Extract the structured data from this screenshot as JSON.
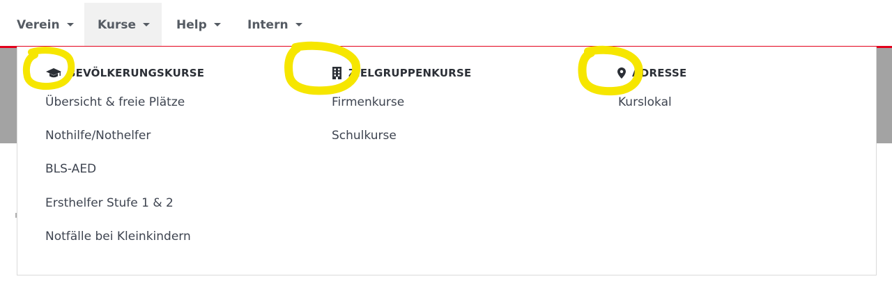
{
  "nav": {
    "items": [
      {
        "label": "Verein"
      },
      {
        "label": "Kurse"
      },
      {
        "label": "Help"
      },
      {
        "label": "Intern"
      }
    ]
  },
  "dropdown": {
    "columns": [
      {
        "heading": "BEVÖLKERUNGSKURSE",
        "icon": "graduation-cap-icon",
        "links": [
          "Übersicht & freie Plätze",
          "Nothilfe/Nothelfer",
          "BLS-AED",
          "Ersthelfer Stufe 1 & 2",
          "Notfälle bei Kleinkindern"
        ]
      },
      {
        "heading": "ZIELGRUPPENKURSE",
        "icon": "building-icon",
        "links": [
          "Firmenkurse",
          "Schulkurse"
        ]
      },
      {
        "heading": "ADRESSE",
        "icon": "map-marker-icon",
        "links": [
          "Kurslokal"
        ]
      }
    ]
  },
  "colors": {
    "accent_red": "#e3001b",
    "highlight_yellow": "#f6e600",
    "hero_gray": "#a3a3a3"
  }
}
